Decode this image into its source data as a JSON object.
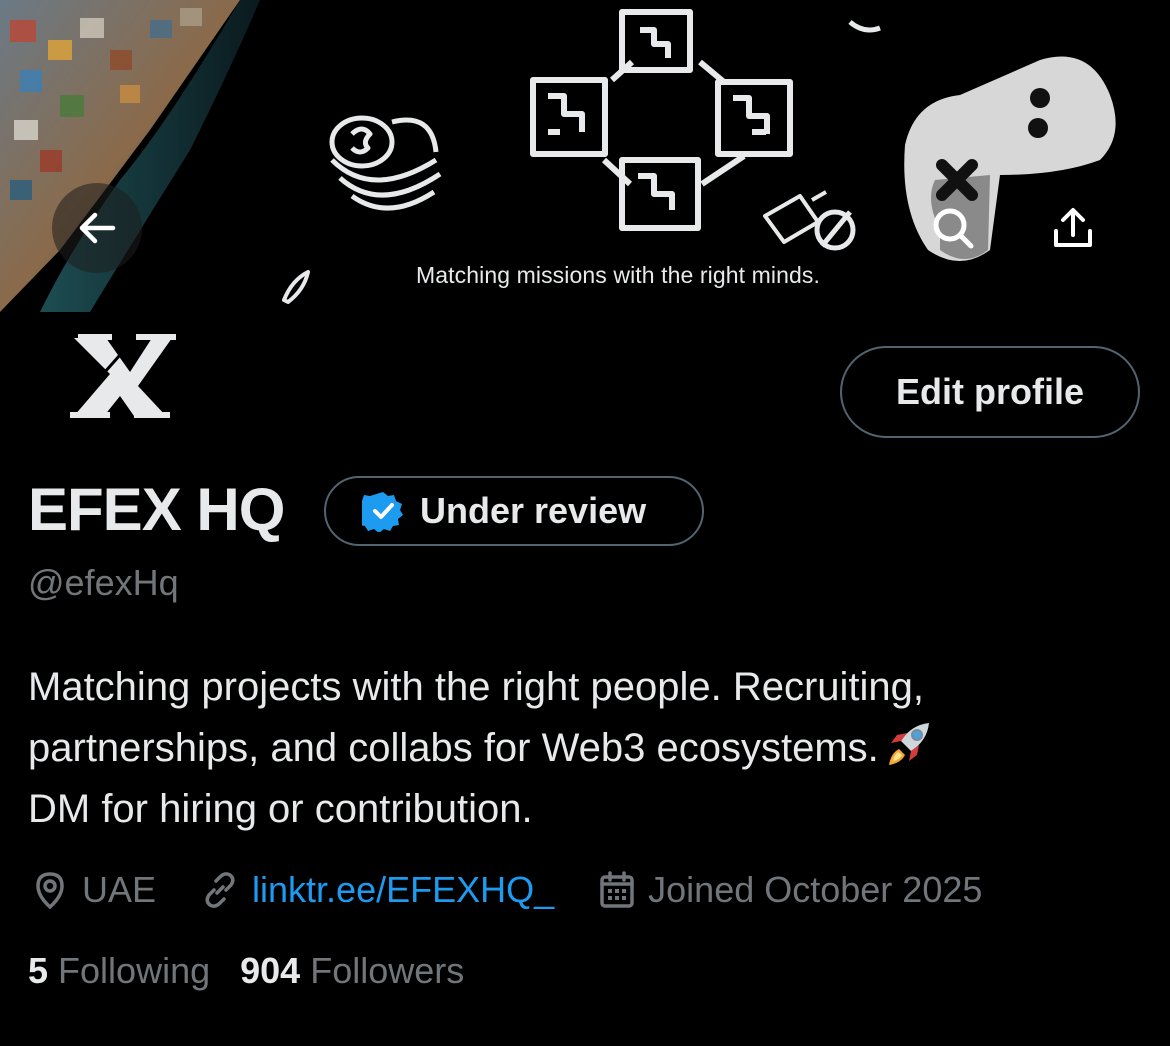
{
  "banner": {
    "tagline": "Matching missions with the right minds."
  },
  "profile": {
    "name": "EFEX HQ",
    "verification_label": "Under review",
    "handle": "@efexHq",
    "bio_lines": [
      "Matching projects with the right people. Recruiting,",
      "partnerships, and collabs for Web3 ecosystems.",
      "DM for hiring or contribution."
    ],
    "location": "UAE",
    "website": "linktr.ee/EFEXHQ_",
    "joined": "Joined October 2025",
    "following_count": "5",
    "following_label": "Following",
    "followers_count": "904",
    "followers_label": "Followers"
  },
  "actions": {
    "edit_profile": "Edit profile"
  },
  "colors": {
    "background": "#000000",
    "text_primary": "#e7e9ea",
    "text_secondary": "#71767b",
    "link": "#1d9bf0",
    "border": "#536471",
    "verified_badge": "#1d9bf0"
  },
  "icons": {
    "back": "arrow-left-icon",
    "search": "search-icon",
    "share": "share-icon",
    "verified": "verified-badge-icon",
    "location": "location-pin-icon",
    "link": "link-icon",
    "calendar": "calendar-icon",
    "rocket": "rocket-emoji"
  }
}
